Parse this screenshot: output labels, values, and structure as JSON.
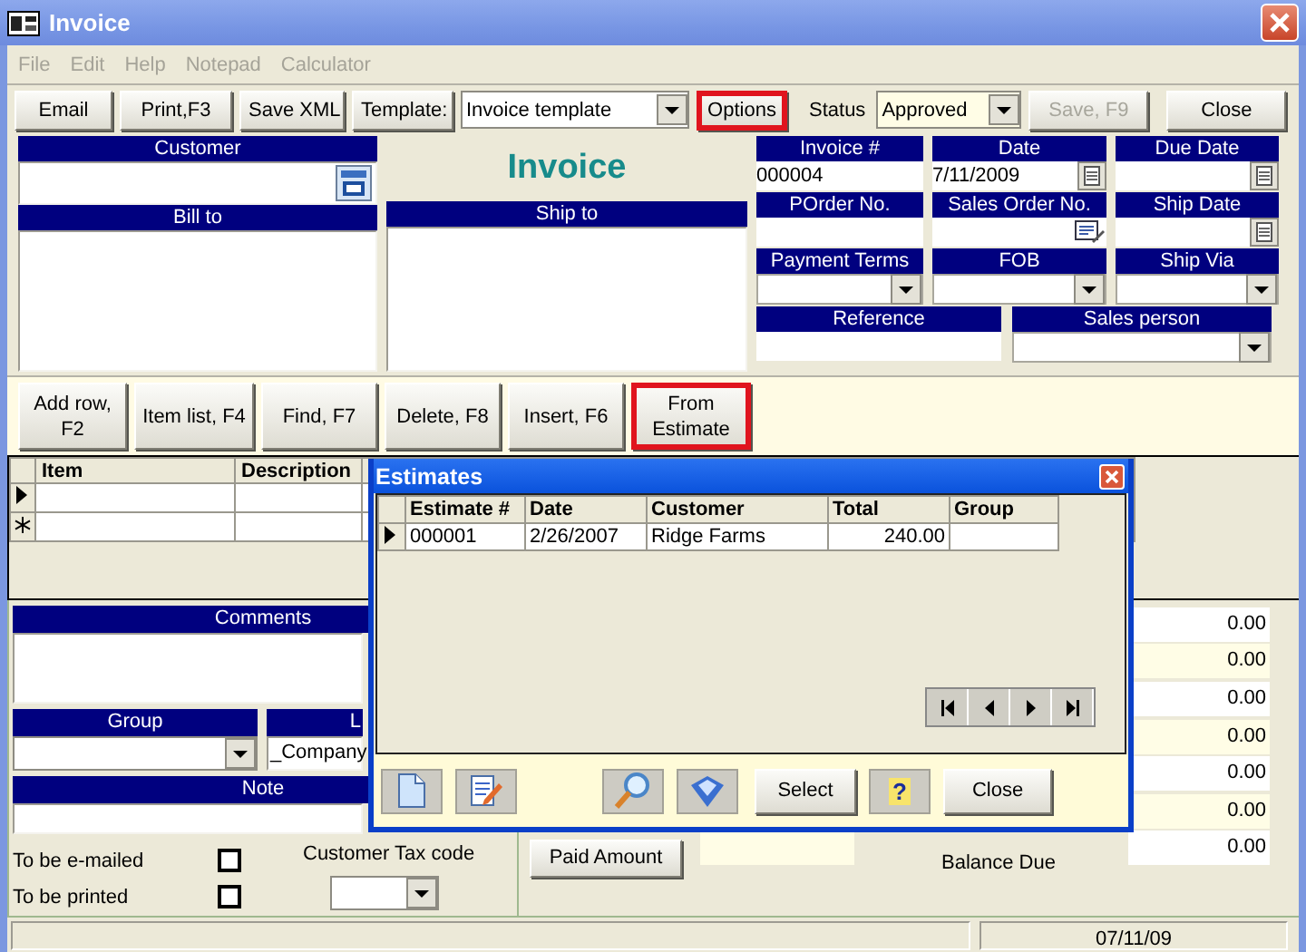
{
  "window": {
    "title": "Invoice"
  },
  "menu": [
    {
      "label": "File",
      "disabled": true
    },
    {
      "label": "Edit",
      "disabled": true
    },
    {
      "label": "Help",
      "disabled": true
    },
    {
      "label": "Notepad",
      "disabled": true
    },
    {
      "label": "Calculator",
      "disabled": true
    }
  ],
  "toolbar": [
    {
      "kind": "button",
      "label": "Email",
      "disabled": false,
      "highlighted": false
    },
    {
      "kind": "button",
      "label": "Print,F3",
      "disabled": false,
      "highlighted": false
    },
    {
      "kind": "button",
      "label": "Save XML",
      "disabled": false,
      "highlighted": false
    },
    {
      "kind": "button",
      "label": "Template:",
      "disabled": false,
      "highlighted": false
    },
    {
      "kind": "select",
      "value": "Invoice template"
    },
    {
      "kind": "button",
      "label": "Options",
      "disabled": false,
      "highlighted": true
    },
    {
      "kind": "label",
      "label": "Status"
    },
    {
      "kind": "select",
      "value": "Approved"
    },
    {
      "kind": "button",
      "label": "Save, F9",
      "disabled": true,
      "highlighted": false
    },
    {
      "kind": "button",
      "label": "Close",
      "disabled": false,
      "highlighted": false
    }
  ],
  "customer": {
    "label": "Customer"
  },
  "bill_to": {
    "label": "Bill to"
  },
  "document_title": "Invoice",
  "ship_to": {
    "label": "Ship to"
  },
  "fields": [
    {
      "label": "Invoice #",
      "value": "000004",
      "kind": "text"
    },
    {
      "label": "Date",
      "value": "7/11/2009",
      "kind": "date"
    },
    {
      "label": "Due Date",
      "kind": "date"
    },
    {
      "label": "POrder No.",
      "kind": "text"
    },
    {
      "label": "Sales Order No.",
      "kind": "lookup"
    },
    {
      "label": "Ship Date",
      "kind": "date"
    },
    {
      "label": "Payment Terms",
      "kind": "select"
    },
    {
      "label": "FOB",
      "kind": "select"
    },
    {
      "label": "Ship Via",
      "kind": "select"
    },
    {
      "label": "Reference",
      "kind": "text"
    },
    {
      "label": "Sales person",
      "kind": "select"
    }
  ],
  "line_buttons": [
    {
      "label": "Add row, F2",
      "highlighted": false
    },
    {
      "label": "Item list, F4",
      "highlighted": false
    },
    {
      "label": "Find, F7",
      "highlighted": false
    },
    {
      "label": "Delete, F8",
      "highlighted": false
    },
    {
      "label": "Insert, F6",
      "highlighted": false
    },
    {
      "label": "From Estimate",
      "highlighted": true
    }
  ],
  "lines_table": {
    "columns": [
      "Item",
      "Description"
    ],
    "rows": [
      {
        "kind": "current"
      },
      {
        "kind": "new"
      }
    ]
  },
  "comments": {
    "label": "Comments"
  },
  "group": {
    "label": "Group"
  },
  "company_field": {
    "label": "L",
    "value": "_Company"
  },
  "note": {
    "label": "Note"
  },
  "flags": [
    {
      "label": "To be e-mailed",
      "checked": false
    },
    {
      "label": "To be printed",
      "checked": false
    }
  ],
  "tax_code": {
    "label": "Customer Tax code"
  },
  "totals": [
    {
      "value": "0.00"
    },
    {
      "value": "0.00"
    },
    {
      "value": "0.00"
    },
    {
      "value": "0.00"
    },
    {
      "value": "0.00"
    },
    {
      "value": "0.00"
    },
    {
      "value": "0.00"
    }
  ],
  "paid_amount_button": "Paid Amount",
  "balance_due_label": "Balance Due",
  "status_bar": {
    "date": "07/11/09"
  },
  "estimates_dialog": {
    "title": "Estimates",
    "columns": [
      "Estimate #",
      "Date",
      "Customer",
      "Total",
      "Group"
    ],
    "rows": [
      {
        "selected": true,
        "cells": [
          "000001",
          "2/26/2007",
          "Ridge Farms",
          "240.00"
        ]
      }
    ],
    "help_button": "?",
    "select_button": "Select",
    "close_button": "Close"
  }
}
